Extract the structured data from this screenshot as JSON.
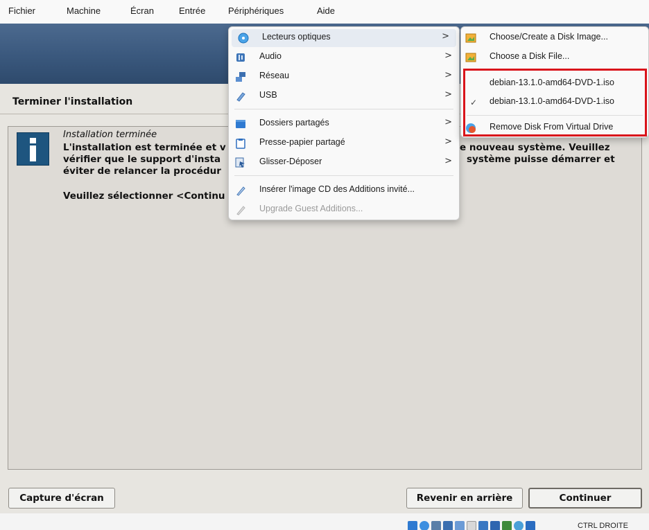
{
  "menubar": {
    "items": [
      {
        "label": "Fichier"
      },
      {
        "label": "Machine"
      },
      {
        "label": "Écran"
      },
      {
        "label": "Entrée"
      },
      {
        "label": "Périphériques"
      },
      {
        "label": "Aide"
      }
    ]
  },
  "installer": {
    "step_title": "Terminer l'installation",
    "info_heading": "Installation terminée",
    "body_left": [
      "L'installation est terminée et v",
      "vérifier que le support d'insta",
      "éviter de relancer la procédur"
    ],
    "body_right": [
      "e nouveau système. Veuillez",
      "système puisse démarrer et"
    ],
    "instruction": "Veuillez sélectionner <Continu",
    "buttons": {
      "screenshot": "Capture d'écran",
      "back": "Revenir en arrière",
      "continue": "Continuer"
    }
  },
  "devices_menu": {
    "items": [
      {
        "label": "Lecteurs optiques",
        "icon": "optical-drive-icon",
        "submenu": true
      },
      {
        "label": "Audio",
        "icon": "audio-icon",
        "submenu": true
      },
      {
        "label": "Réseau",
        "icon": "network-icon",
        "submenu": true
      },
      {
        "label": "USB",
        "icon": "usb-icon",
        "submenu": true
      },
      {
        "label": "Dossiers partagés",
        "icon": "shared-folder-icon",
        "submenu": true
      },
      {
        "label": "Presse-papier partagé",
        "icon": "clipboard-icon",
        "submenu": true
      },
      {
        "label": "Glisser-Déposer",
        "icon": "drag-drop-icon",
        "submenu": true
      },
      {
        "label": "Insérer l'image CD des Additions invité...",
        "icon": "guest-additions-cd-icon",
        "submenu": false
      },
      {
        "label": "Upgrade Guest Additions...",
        "icon": "upgrade-additions-icon",
        "submenu": false,
        "disabled": true
      }
    ],
    "arrow_glyph": ">"
  },
  "optical_submenu": {
    "choose_create": "Choose/Create a Disk Image...",
    "choose_file": "Choose a Disk File...",
    "recent_1": "debian-13.1.0-amd64-DVD-1.iso",
    "recent_2": "debian-13.1.0-amd64-DVD-1.iso",
    "check_glyph": "✓",
    "remove": "Remove Disk From Virtual Drive"
  },
  "statusbar": {
    "host_key": "CTRL DROITE"
  },
  "colors": {
    "highlight_box": "#d9141b",
    "banner": "#3a587d",
    "info_icon": "#1e557f"
  }
}
